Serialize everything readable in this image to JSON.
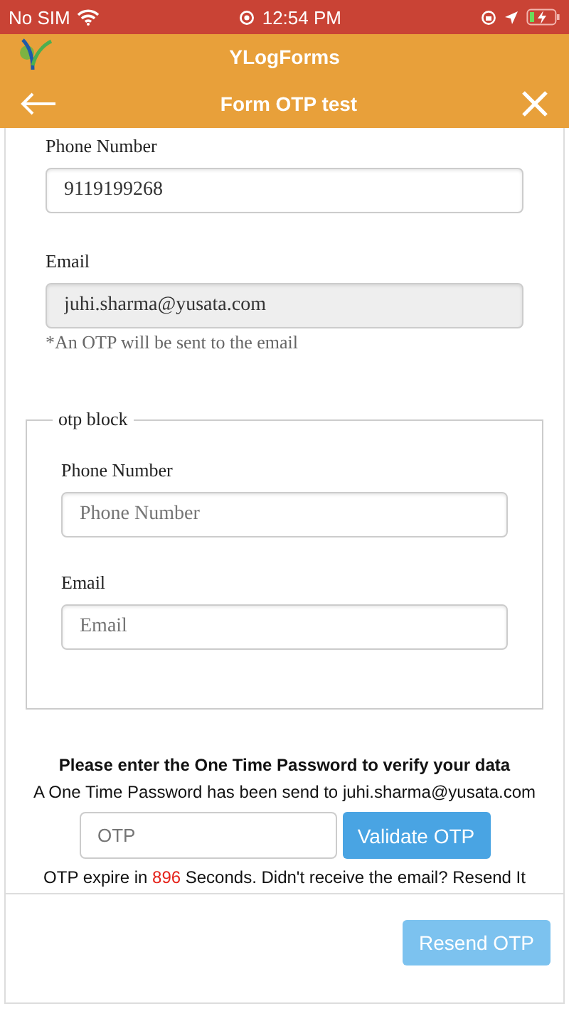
{
  "status_bar": {
    "carrier": "No SIM",
    "time": "12:54 PM"
  },
  "header": {
    "app_title": "YLogForms",
    "form_title": "Form OTP test"
  },
  "fields": [
    {
      "label": "Phone Number",
      "value": "9119199268",
      "disabled": false
    },
    {
      "label": "Email",
      "value": "juhi.sharma@yusata.com",
      "disabled": true,
      "hint": "*An OTP will be sent to the email"
    }
  ],
  "otp_block": {
    "legend": "otp block",
    "fields": [
      {
        "label": "Phone Number",
        "placeholder": "Phone Number"
      },
      {
        "label": "Email",
        "placeholder": "Email"
      }
    ]
  },
  "verify": {
    "title": "Please enter the One Time Password to verify your data",
    "message": "A One Time Password has been send to juhi.sharma@yusata.com",
    "otp_placeholder": "OTP",
    "validate_button": "Validate OTP",
    "expire_prefix": "OTP expire in ",
    "expire_seconds": "896",
    "expire_suffix": " Seconds. Didn't receive the email? Resend It"
  },
  "resend_button": {
    "label": "Resend OTP",
    "disabled": true
  }
}
